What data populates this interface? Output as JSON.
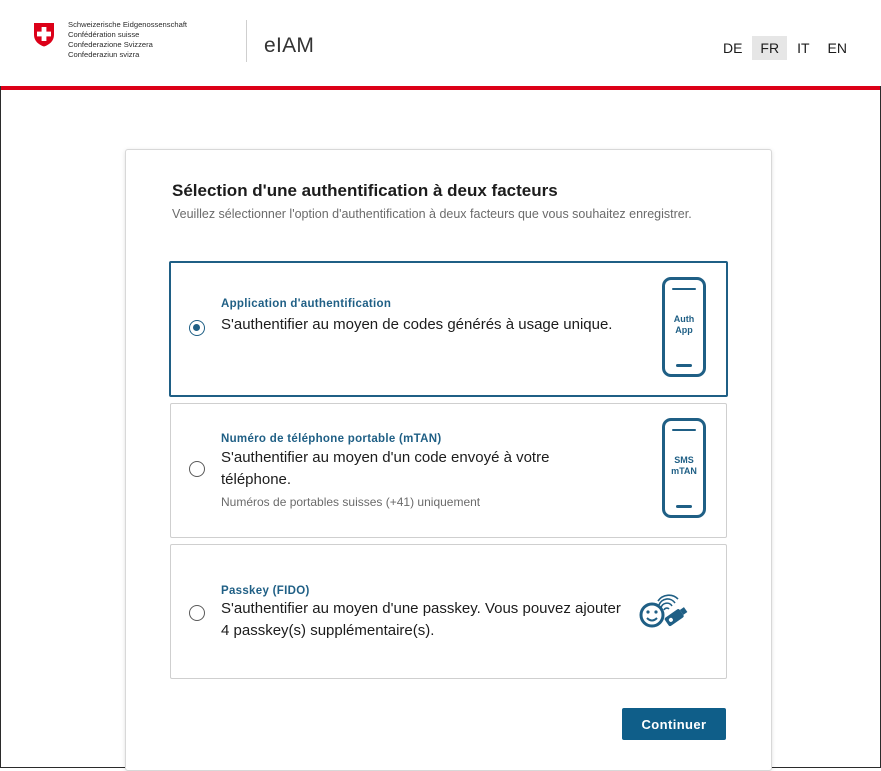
{
  "header": {
    "confederation_lines": [
      "Schweizerische Eidgenossenschaft",
      "Confédération suisse",
      "Confederazione Svizzera",
      "Confederaziun svizra"
    ],
    "app_name": "eIAM",
    "languages": [
      "DE",
      "FR",
      "IT",
      "EN"
    ],
    "active_language": "FR"
  },
  "card": {
    "title": "Sélection d'une authentification à deux facteurs",
    "description": "Veuillez sélectionner l'option d'authentification à deux facteurs que vous souhaitez enregistrer."
  },
  "options": [
    {
      "label": "Application d'authentification",
      "text": "S'authentifier au moyen de codes générés à usage unique.",
      "icon": "auth-app-phone-icon",
      "icon_text_1": "Auth",
      "icon_text_2": "App",
      "selected": true
    },
    {
      "label": "Numéro de téléphone portable (mTAN)",
      "text": "S'authentifier au moyen d'un code envoyé à votre téléphone.",
      "hint": "Numéros de portables suisses (+41) uniquement",
      "icon": "sms-phone-icon",
      "icon_text_1": "SMS",
      "icon_text_2": "mTAN",
      "selected": false
    },
    {
      "label": "Passkey (FIDO)",
      "text": "S'authentifier au moyen d'une passkey. Vous pouvez ajouter 4 passkey(s) supplémentaire(s).",
      "icon": "passkey-icon",
      "selected": false
    }
  ],
  "continue_label": "Continuer",
  "colors": {
    "accent": "#1f5f85",
    "button": "#0f5e89",
    "brand_red": "#dc0018"
  }
}
